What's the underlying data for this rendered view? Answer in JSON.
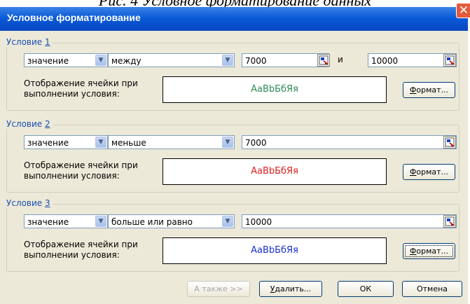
{
  "caption": "Рис. 4 Условное форматирование данных",
  "dialog": {
    "title": "Условное форматирование",
    "close_label": "✕"
  },
  "conditions": [
    {
      "legend_text": "Условие ",
      "legend_num": "1",
      "type_value": "значение",
      "operator_value": "между",
      "value1": "7000",
      "and_label": "и",
      "value2": "10000",
      "desc_line1": "Отображение ячейки при",
      "desc_line2": "выполнении условия:",
      "preview_text": "АаBbБбЯя",
      "preview_color": "#2e8b57",
      "format_button": "Формат..."
    },
    {
      "legend_text": "Условие ",
      "legend_num": "2",
      "type_value": "значение",
      "operator_value": "меньше",
      "value1": "7000",
      "desc_line1": "Отображение ячейки при",
      "desc_line2": "выполнении условия:",
      "preview_text": "АаBbБбЯя",
      "preview_color": "#e02020",
      "format_button": "Формат..."
    },
    {
      "legend_text": "Условие ",
      "legend_num": "3",
      "type_value": "значение",
      "operator_value": "больше или равно",
      "value1": "10000",
      "desc_line1": "Отображение ячейки при",
      "desc_line2": "выполнении условия:",
      "preview_text": "АаBbБбЯя",
      "preview_color": "#1a2fd6",
      "format_button": "Формат..."
    }
  ],
  "footer": {
    "also_label": "А также >>",
    "delete_label": "Удалить...",
    "ok_label": "ОК",
    "cancel_label": "Отмена"
  },
  "icons": {
    "combo_arrow": "chevron-down-icon",
    "range_picker": "collapse-dialog-icon"
  }
}
